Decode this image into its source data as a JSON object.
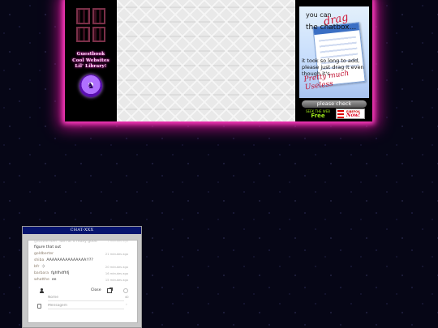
{
  "left_nav": {
    "links": [
      "Guestbook",
      "Cool Websites",
      "Lil' Library!"
    ]
  },
  "promo": {
    "line1": "you can",
    "drag_word": "drag",
    "line2": "the chatbox...",
    "line3": "it took so long to add, please just drag it even though it's",
    "line4": "Pretty much Useless"
  },
  "right_col": {
    "please_check": "please check",
    "free_small": "SEEK THE WEB",
    "free_label": "Free",
    "now_small": "FIREFOX",
    "now_label": "Now!"
  },
  "chat": {
    "title": "CHAT-XXX",
    "messages": [
      {
        "name": "gazzbomber",
        "text": "Iam ot it really good",
        "time": "1 minutes ago",
        "faded": true
      },
      {
        "name": "",
        "text": "figure that out",
        "time": "",
        "faded": false
      },
      {
        "name": "goldberter",
        "text": "",
        "time": "21 minutes ago",
        "faded": false
      },
      {
        "name": "shiba",
        "text": "AAAAAAAAAAAAAAA!!??",
        "time": "",
        "faded": false
      },
      {
        "name": "bfr",
        "text": ":)",
        "time": "20 minutes ago",
        "faded": false
      },
      {
        "name": "barbara",
        "text": "fghfhdfhfj",
        "time": "16 minutes ago",
        "faded": false
      },
      {
        "name": "whatthe",
        "text": "ee",
        "time": "15 minutes ago",
        "faded": false
      }
    ],
    "close_label": "Close",
    "name_placeholder": "Nome",
    "name_counter": "40",
    "message_placeholder": "Mensagem",
    "send_glyph": "›"
  }
}
